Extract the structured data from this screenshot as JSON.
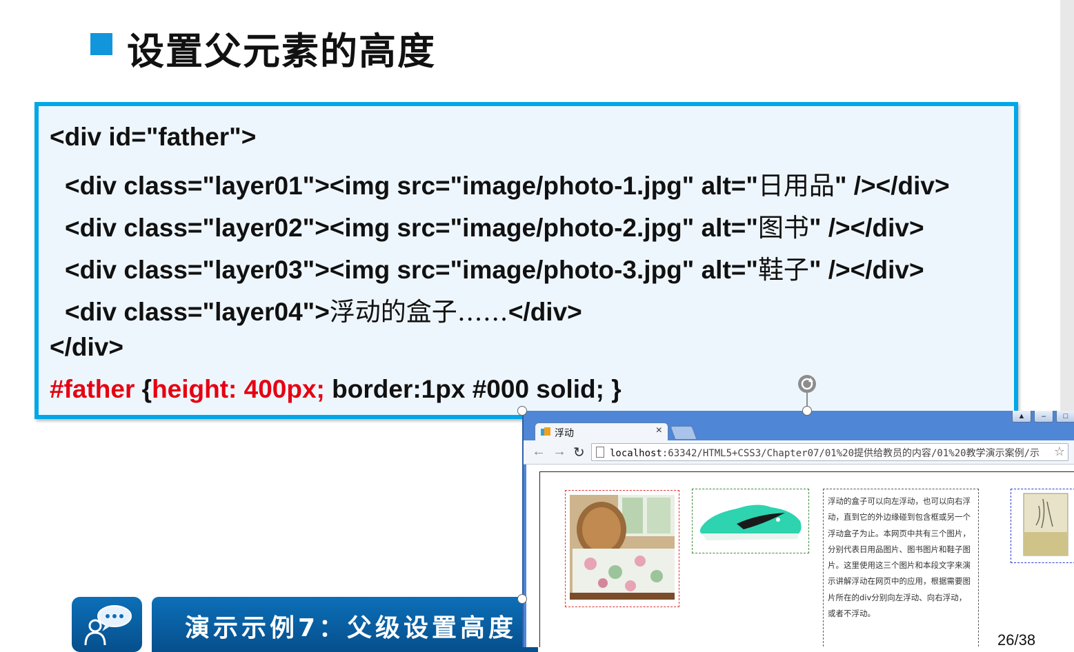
{
  "slide": {
    "title": "设置父元素的高度",
    "page_number": "26/38"
  },
  "code": {
    "line1": "<div id=\"father\">",
    "line2": {
      "pre": "<div class=\"layer01\"><img src=\"image/photo-1.jpg\" alt=\"",
      "cn": "日用品",
      "post": "\" /></div>"
    },
    "line3": {
      "pre": "<div class=\"layer02\"><img src=\"image/photo-2.jpg\" alt=\"",
      "cn": "图书",
      "post": "\" /></div>"
    },
    "line4": {
      "pre": "<div class=\"layer03\"><img src=\"image/photo-3.jpg\" alt=\"",
      "cn": "鞋子",
      "post": "\" /></div>"
    },
    "line5": {
      "pre": "<div class=\"layer04\">",
      "cn": "浮动的盒子……",
      "post": "</div>"
    },
    "line6": "</div>",
    "line7": {
      "sel": "#father ",
      "open": "{",
      "decl": "height: 400px;",
      "rest": " border:1px #000 solid; }"
    }
  },
  "banner": {
    "text": "演示示例7：父级设置高度",
    "icon": "chat-people-icon"
  },
  "browser": {
    "tab_title": "浮动",
    "tab_close": "×",
    "url_host": "localhost",
    "url_path": ":63342/HTML5+CSS3/Chapter07/01%20提供给教员的内容/01%20教学演示案例/示",
    "back": "←",
    "forward": "→",
    "reload": "↻",
    "star": "☆",
    "win_buttons": [
      "▲",
      "–",
      "□"
    ],
    "paragraph": "浮动的盒子可以向左浮动，也可以向右浮动，直到它的外边缘碰到包含框或另一个浮动盒子为止。本网页中共有三个图片，分别代表日用品图片、图书图片和鞋子图片。这里使用这三个图片和本段文字来演示讲解浮动在网页中的应用，根据需要图片所在的div分别向左浮动、向右浮动，或者不浮动。"
  },
  "colors": {
    "accent": "#00a7e8",
    "title_square": "#1296db",
    "code_red": "#e60012",
    "banner": "#0c6fb8"
  }
}
